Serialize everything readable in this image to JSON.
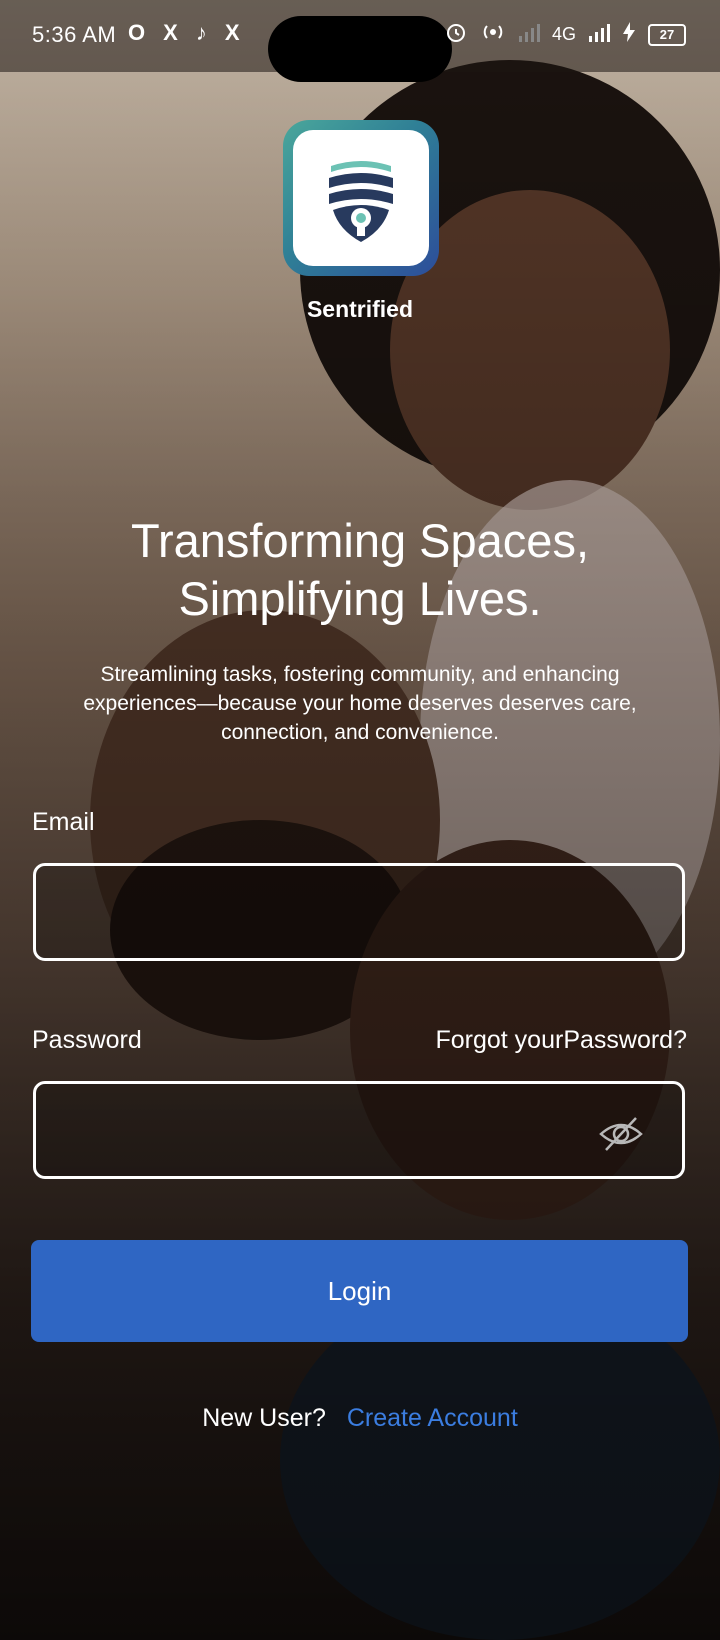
{
  "status_bar": {
    "time": "5:36 AM",
    "left_icons": [
      "O",
      "X",
      "♪",
      "X"
    ],
    "network": "4G",
    "battery": "27"
  },
  "app": {
    "name": "Sentrified"
  },
  "hero": {
    "headline_line1": "Transforming Spaces,",
    "headline_line2": "Simplifying Lives.",
    "subtitle": "Streamlining tasks, fostering community, and enhancing experiences—because your home deserves  deserves care, connection, and convenience."
  },
  "form": {
    "email_label": "Email",
    "email_value": "",
    "password_label": "Password",
    "password_value": "",
    "forgot_label": "Forgot yourPassword?",
    "login_label": "Login"
  },
  "footer": {
    "new_user_label": "New User?",
    "create_account_label": "Create Account"
  },
  "colors": {
    "primary": "#2f66c3",
    "link": "#3b7de0"
  }
}
